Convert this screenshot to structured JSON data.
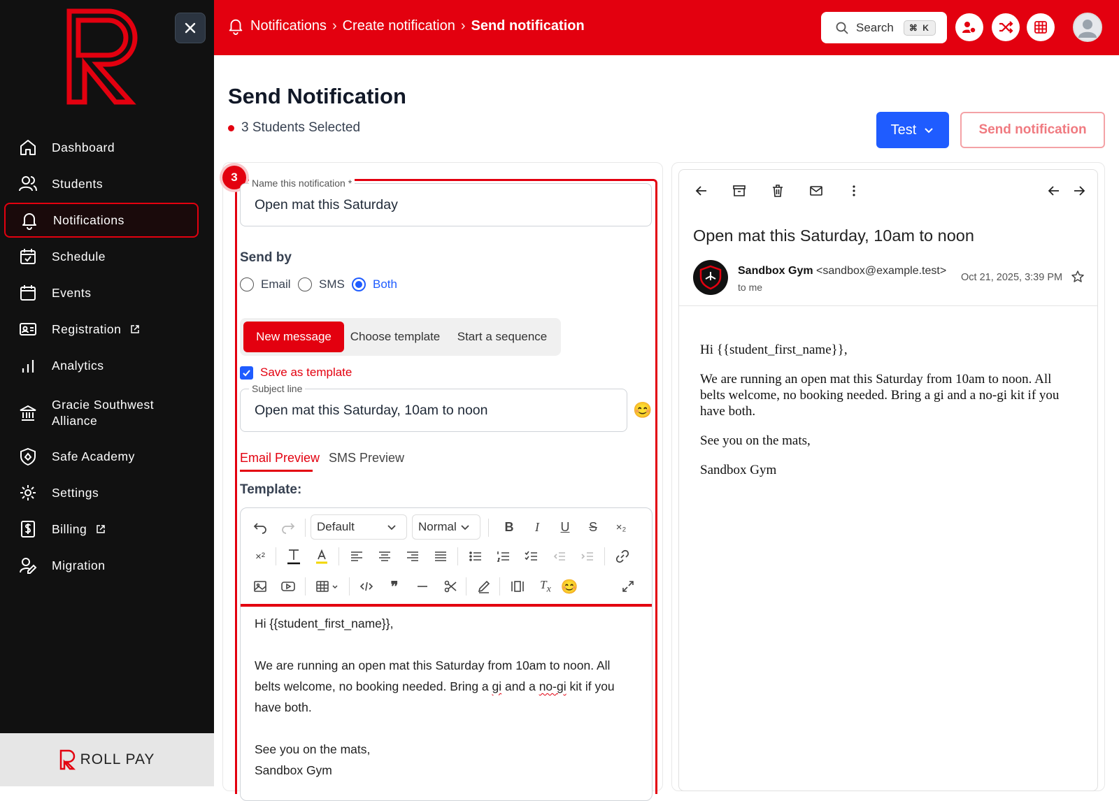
{
  "sidebar": {
    "items": [
      {
        "label": "Dashboard",
        "icon": "home-icon"
      },
      {
        "label": "Students",
        "icon": "users-icon"
      },
      {
        "label": "Notifications",
        "icon": "bell-icon",
        "active": true
      },
      {
        "label": "Schedule",
        "icon": "calendar-check-icon"
      },
      {
        "label": "Events",
        "icon": "calendar-icon"
      },
      {
        "label": "Registration",
        "icon": "id-card-icon",
        "external": true
      },
      {
        "label": "Analytics",
        "icon": "bar-chart-icon"
      },
      {
        "label": "Gracie Southwest Alliance",
        "icon": "bank-icon"
      },
      {
        "label": "Safe Academy",
        "icon": "shield-icon"
      },
      {
        "label": "Settings",
        "icon": "gear-icon"
      },
      {
        "label": "Billing",
        "icon": "dollar-icon",
        "external": true
      },
      {
        "label": "Migration",
        "icon": "user-edit-icon"
      }
    ],
    "footer_label": "ROLL PAY"
  },
  "header": {
    "breadcrumb": [
      "Notifications",
      "Create notification",
      "Send notification"
    ],
    "search_label": "Search",
    "search_shortcut": "⌘ K",
    "accent": "#e3000f"
  },
  "page": {
    "title": "Send Notification",
    "selected": "3 Students Selected",
    "test_label": "Test",
    "send_label": "Send notification",
    "step": "3"
  },
  "form": {
    "name_label": "Name this notification *",
    "name_value": "Open mat this Saturday",
    "send_by_label": "Send by",
    "send_by_options": [
      "Email",
      "SMS",
      "Both"
    ],
    "send_by_selected": "Both",
    "segments": [
      "New message",
      "Choose template",
      "Start a sequence"
    ],
    "save_template_label": "Save as template",
    "subject_label": "Subject line",
    "subject_value": "Open mat this Saturday, 10am to noon",
    "tabs": [
      "Email Preview",
      "SMS Preview"
    ],
    "template_label": "Template:",
    "editor": {
      "font_select": "Default",
      "style_select": "Normal",
      "body": {
        "greeting": "Hi {{student_first_name}},",
        "p1_a": "We are running an open mat this Saturday from 10am to noon. All belts welcome, no booking needed. Bring a ",
        "p1_gi": "gi",
        "p1_b": " and a ",
        "p1_nogi": "no-gi",
        "p1_c": " kit if you have both.",
        "closing": "See you on the mats,",
        "signature": "Sandbox Gym"
      }
    }
  },
  "preview": {
    "subject": "Open mat this Saturday, 10am to noon",
    "sender_name": "Sandbox Gym",
    "sender_email": "<sandbox@example.test>",
    "to": "to me",
    "date": "Oct 21, 2025, 3:39 PM",
    "body": [
      "Hi {{student_first_name}},",
      "We are running an open mat this Saturday from 10am to noon. All belts welcome, no booking needed. Bring a gi and a no-gi kit if you have both.",
      "See you on the mats,",
      "Sandbox Gym"
    ]
  }
}
